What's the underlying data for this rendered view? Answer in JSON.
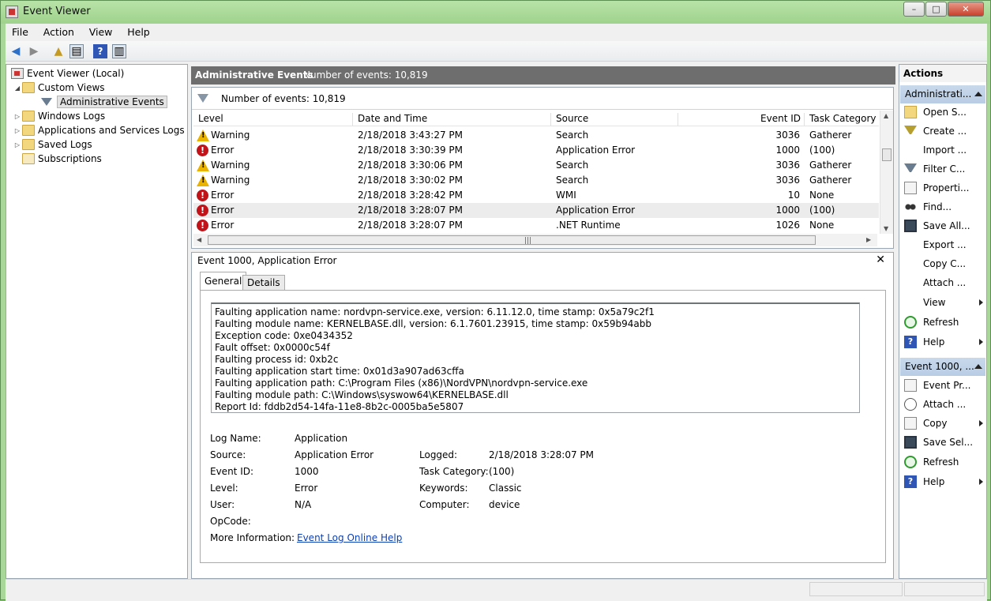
{
  "window": {
    "title": "Event Viewer",
    "buttons": {
      "minimize": "–",
      "maximize": "□",
      "close": "✕"
    }
  },
  "menu": [
    "File",
    "Action",
    "View",
    "Help"
  ],
  "toolbar": {
    "icons": [
      "back-icon",
      "forward-icon",
      "up-folder-icon",
      "show-hide-console-tree-icon",
      "help-icon",
      "show-hide-action-pane-icon"
    ]
  },
  "tree": {
    "root": "Event Viewer (Local)",
    "custom_views": "Custom Views",
    "admin_events": "Administrative Events",
    "windows_logs": "Windows Logs",
    "app_services_logs": "Applications and Services Logs",
    "saved_logs": "Saved Logs",
    "subscriptions": "Subscriptions"
  },
  "list": {
    "header_title": "Administrative Events",
    "header_count": "Number of events: 10,819",
    "filter_text": "Number of events: 10,819",
    "columns": [
      "Level",
      "Date and Time",
      "Source",
      "Event ID",
      "Task Category"
    ],
    "rows": [
      {
        "level": "Warning",
        "datetime": "2/18/2018 3:43:27 PM",
        "source": "Search",
        "event_id": "3036",
        "task": "Gatherer",
        "icon": "warning-icon"
      },
      {
        "level": "Error",
        "datetime": "2/18/2018 3:30:39 PM",
        "source": "Application Error",
        "event_id": "1000",
        "task": "(100)",
        "icon": "error-icon"
      },
      {
        "level": "Warning",
        "datetime": "2/18/2018 3:30:06 PM",
        "source": "Search",
        "event_id": "3036",
        "task": "Gatherer",
        "icon": "warning-icon"
      },
      {
        "level": "Warning",
        "datetime": "2/18/2018 3:30:02 PM",
        "source": "Search",
        "event_id": "3036",
        "task": "Gatherer",
        "icon": "warning-icon"
      },
      {
        "level": "Error",
        "datetime": "2/18/2018 3:28:42 PM",
        "source": "WMI",
        "event_id": "10",
        "task": "None",
        "icon": "error-icon"
      },
      {
        "level": "Error",
        "datetime": "2/18/2018 3:28:07 PM",
        "source": "Application Error",
        "event_id": "1000",
        "task": "(100)",
        "icon": "error-icon"
      },
      {
        "level": "Error",
        "datetime": "2/18/2018 3:28:07 PM",
        "source": ".NET Runtime",
        "event_id": "1026",
        "task": "None",
        "icon": "error-icon"
      }
    ]
  },
  "detail": {
    "title": "Event 1000, Application Error",
    "close": "✕",
    "tabs": [
      "General",
      "Details"
    ],
    "message": [
      "Faulting application name: nordvpn-service.exe, version: 6.11.12.0, time stamp: 0x5a79c2f1",
      "Faulting module name: KERNELBASE.dll, version: 6.1.7601.23915, time stamp: 0x59b94abb",
      "Exception code: 0xe0434352",
      "Fault offset: 0x0000c54f",
      "Faulting process id: 0xb2c",
      "Faulting application start time: 0x01d3a907ad63cffa",
      "Faulting application path: C:\\Program Files (x86)\\NordVPN\\nordvpn-service.exe",
      "Faulting module path: C:\\Windows\\syswow64\\KERNELBASE.dll",
      "Report Id: fddb2d54-14fa-11e8-8b2c-0005ba5e5807"
    ],
    "fields": {
      "log_name_label": "Log Name:",
      "log_name": "Application",
      "source_label": "Source:",
      "source": "Application Error",
      "logged_label": "Logged:",
      "logged": "2/18/2018 3:28:07 PM",
      "event_id_label": "Event ID:",
      "event_id": "1000",
      "task_label": "Task Category:",
      "task": "(100)",
      "level_label": "Level:",
      "level": "Error",
      "keywords_label": "Keywords:",
      "keywords": "Classic",
      "user_label": "User:",
      "user": "N/A",
      "computer_label": "Computer:",
      "computer": "device",
      "opcode_label": "OpCode:",
      "opcode": "",
      "more_info_label": "More Information:",
      "more_info_link": "Event Log Online Help"
    }
  },
  "actions": {
    "header": "Actions",
    "section1": "Administrati...",
    "items1": [
      {
        "label": "Open S...",
        "icon": "open-folder-icon",
        "sub": false
      },
      {
        "label": "Create ...",
        "icon": "create-view-icon",
        "sub": false
      },
      {
        "label": "Import ...",
        "icon": "",
        "sub": false
      },
      {
        "label": "Filter C...",
        "icon": "filter-icon",
        "sub": false
      },
      {
        "label": "Properti...",
        "icon": "properties-icon",
        "sub": false
      },
      {
        "label": "Find...",
        "icon": "find-icon",
        "sub": false
      },
      {
        "label": "Save All...",
        "icon": "save-icon",
        "sub": false
      },
      {
        "label": "Export ...",
        "icon": "",
        "sub": false
      },
      {
        "label": "Copy C...",
        "icon": "",
        "sub": false
      },
      {
        "label": "Attach ...",
        "icon": "",
        "sub": false
      },
      {
        "label": "View",
        "icon": "",
        "sub": true
      },
      {
        "label": "Refresh",
        "icon": "refresh-icon",
        "sub": false
      },
      {
        "label": "Help",
        "icon": "help-icon",
        "sub": true
      }
    ],
    "section2": "Event 1000, ...",
    "items2": [
      {
        "label": "Event Pr...",
        "icon": "event-properties-icon",
        "sub": false
      },
      {
        "label": "Attach ...",
        "icon": "attach-task-icon",
        "sub": false
      },
      {
        "label": "Copy",
        "icon": "copy-icon",
        "sub": true
      },
      {
        "label": "Save Sel...",
        "icon": "save-icon",
        "sub": false
      },
      {
        "label": "Refresh",
        "icon": "refresh-icon",
        "sub": false
      },
      {
        "label": "Help",
        "icon": "help-icon",
        "sub": true
      }
    ]
  }
}
